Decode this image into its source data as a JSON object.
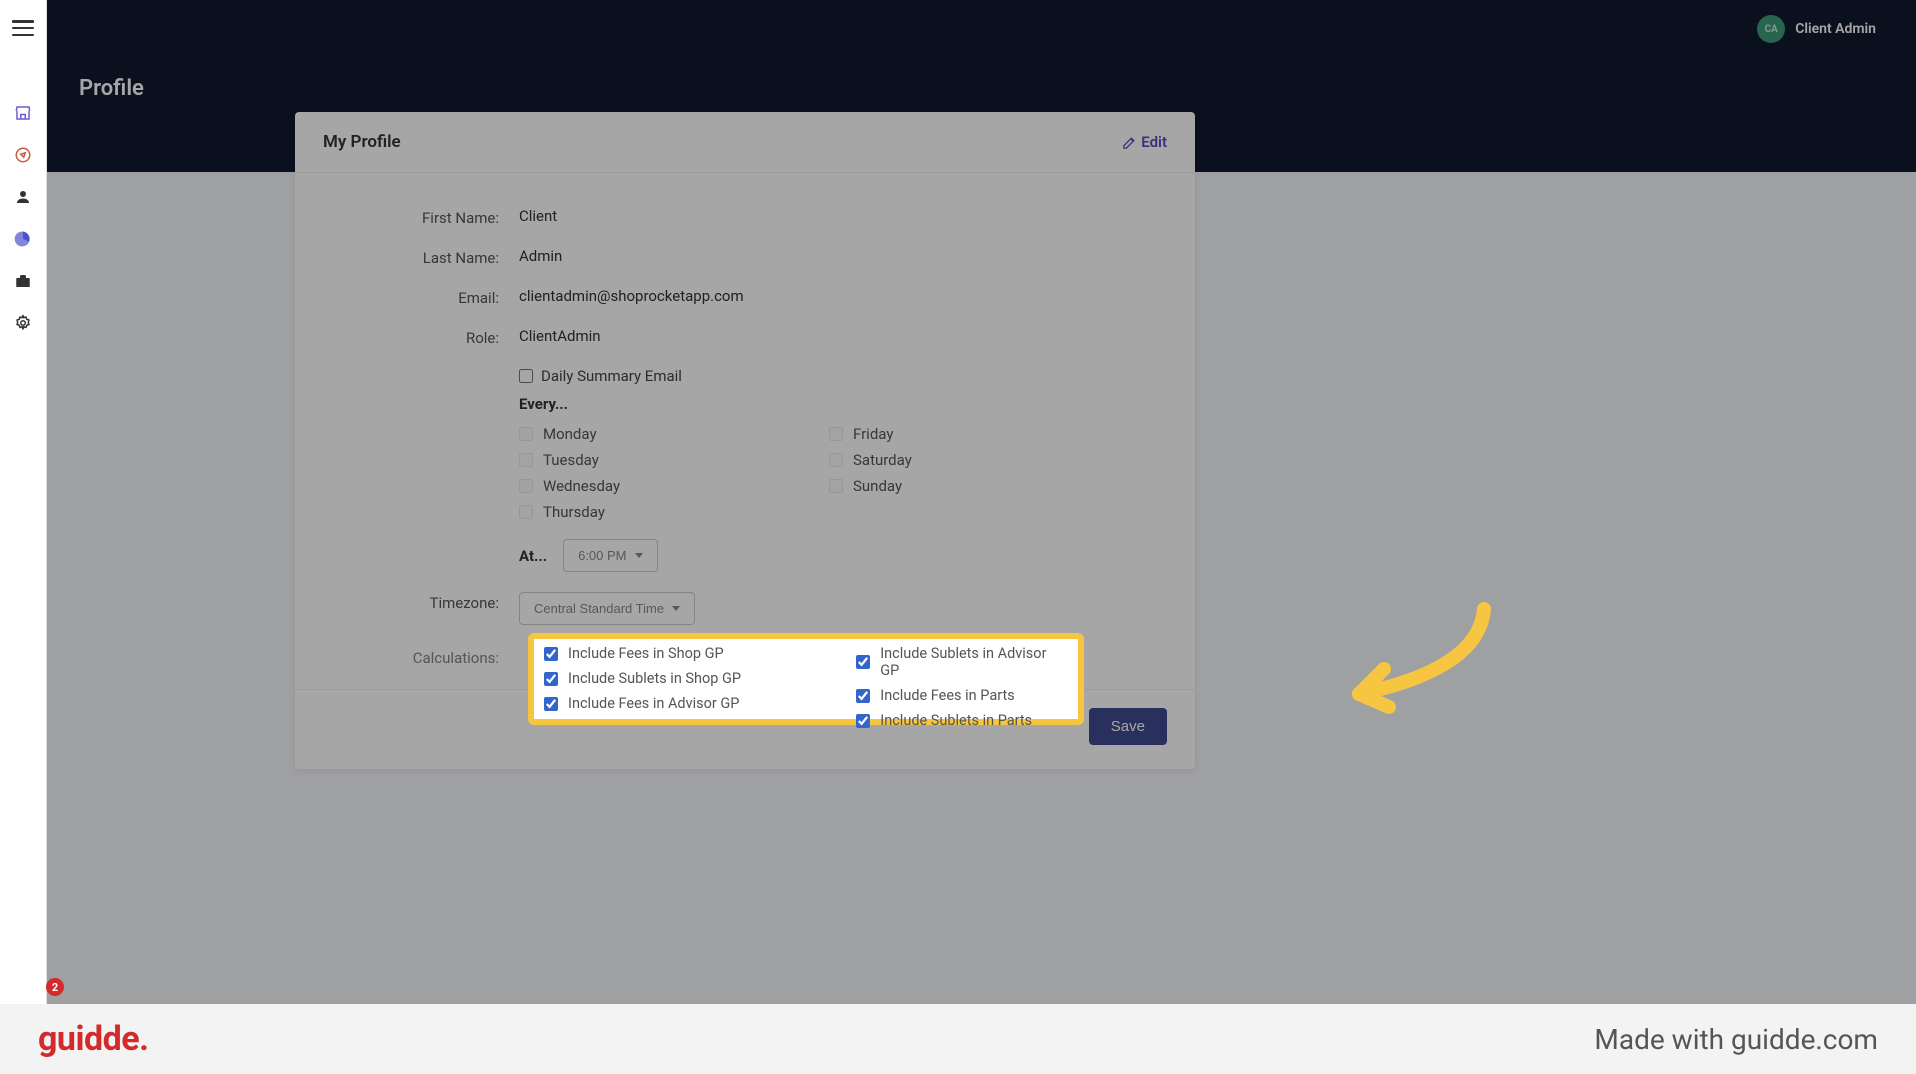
{
  "user": {
    "initials": "CA",
    "name": "Client Admin"
  },
  "page": {
    "title": "Profile"
  },
  "card": {
    "title": "My Profile",
    "edit_label": "Edit"
  },
  "profile": {
    "first_name_label": "First Name:",
    "first_name_value": "Client",
    "last_name_label": "Last Name:",
    "last_name_value": "Admin",
    "email_label": "Email:",
    "email_value": "clientadmin@shoprocketapp.com",
    "role_label": "Role:",
    "role_value": "ClientAdmin",
    "daily_summary_label": "Daily Summary Email",
    "every_label": "Every...",
    "days_col1": [
      "Monday",
      "Tuesday",
      "Wednesday",
      "Thursday"
    ],
    "days_col2": [
      "Friday",
      "Saturday",
      "Sunday"
    ],
    "at_label": "At...",
    "time_value": "6:00 PM",
    "timezone_label": "Timezone:",
    "timezone_value": "Central Standard Time",
    "calculations_label": "Calculations:",
    "calc_col1": [
      "Include Fees in Shop GP",
      "Include Sublets in Shop GP",
      "Include Fees in Advisor GP"
    ],
    "calc_col2": [
      "Include Sublets in Advisor GP",
      "Include Fees in Parts",
      "Include Sublets in Parts"
    ],
    "save_label": "Save"
  },
  "branding": {
    "logo": "guidde.",
    "made_with": "Made with guidde.com"
  },
  "notif_count": "2"
}
